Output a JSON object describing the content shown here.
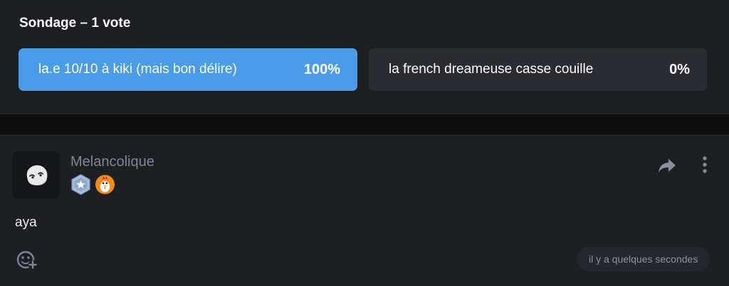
{
  "poll": {
    "title": "Sondage – 1 vote",
    "options": [
      {
        "label": "la.e 10/10 à kiki (mais bon délire)",
        "percent": "100%",
        "color": "#4a9be8"
      },
      {
        "label": "la french dreameuse casse couille",
        "percent": "0%",
        "color": "#2a2c32"
      }
    ]
  },
  "post": {
    "author": "Melancolique",
    "badges": [
      "star-shield-badge-icon",
      "chicken-badge-icon"
    ],
    "message": "aya",
    "timestamp": "il y a quelques secondes"
  },
  "colors": {
    "background": "#0f0f10",
    "card": "#1e1f23",
    "accent": "#4a9be8",
    "muted": "#7f8499"
  }
}
